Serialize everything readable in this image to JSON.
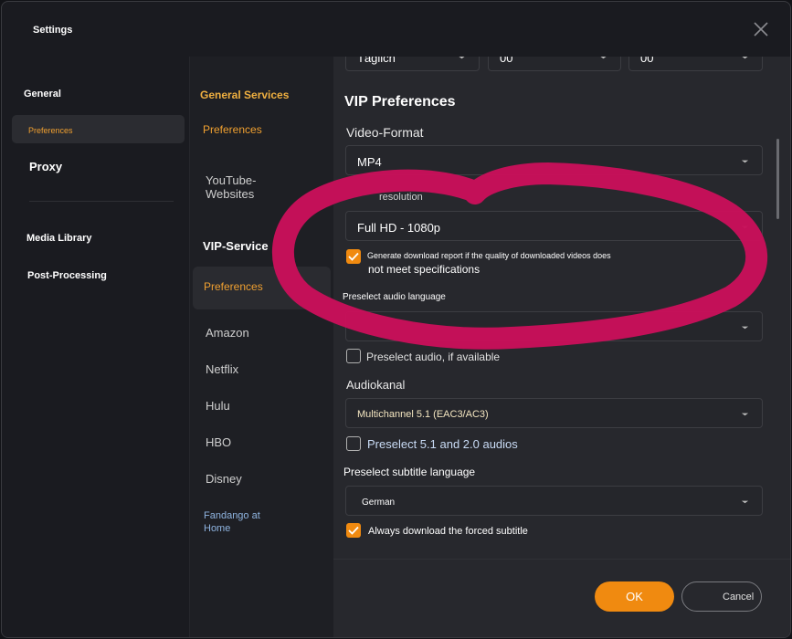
{
  "window": {
    "title": "Settings"
  },
  "left_nav": {
    "general": "General",
    "preferences": "Preferences",
    "proxy": "Proxy",
    "media_library": "Media Library",
    "post_processing": "Post-Processing"
  },
  "mid_nav": {
    "general_services": "General Services",
    "preferences1": "Preferences",
    "youtube": "YouTube-\nWebsites",
    "vip_service": "VIP-Service",
    "preferences2": "Preferences",
    "amazon": "Amazon",
    "netflix": "Netflix",
    "hulu": "Hulu",
    "hbo": "HBO",
    "disney": "Disney",
    "fandango": "Fandango at\nHome"
  },
  "top_row": {
    "schedule": "Täglich",
    "hour": "00",
    "minute": "00"
  },
  "vip": {
    "heading": "VIP Preferences",
    "video_format_label": "Video-Format",
    "video_format_value": "MP4",
    "resolution_label": "resolution",
    "resolution_value": "Full HD - 1080p",
    "report_check_line1": "Generate download report if the quality of downloaded videos does",
    "report_check_line2": "not meet specifications",
    "audio_lang_label": "Preselect audio language",
    "audio_lang_value": "",
    "preselect_audio": "Preselect audio, if available",
    "audiokanal_label": "Audiokanal",
    "audiokanal_value": "Multichannel 5.1 (EAC3/AC3)",
    "preselect_51": "Preselect 5.1 and 2.0 audios",
    "subtitle_label": "Preselect subtitle language",
    "subtitle_value": "German",
    "forced_subtitle": "Always download the forced subtitle"
  },
  "footer": {
    "ok": "OK",
    "cancel": "Cancel"
  },
  "colors": {
    "accent": "#f08a10",
    "annotation": "#c8105a"
  }
}
